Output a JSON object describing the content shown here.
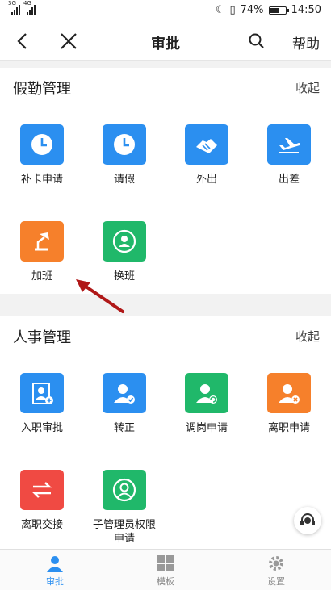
{
  "status_bar": {
    "signal1": "3G",
    "signal2": "4G",
    "battery": "74%",
    "battery_level": 0.74,
    "time": "14:50"
  },
  "header": {
    "title": "审批",
    "help": "帮助"
  },
  "sections": [
    {
      "title": "假勤管理",
      "collapse": "收起",
      "items": [
        {
          "label": "补卡申请",
          "color": "#2b8ff0",
          "icon": "clock-icon"
        },
        {
          "label": "请假",
          "color": "#2b8ff0",
          "icon": "clock-icon"
        },
        {
          "label": "外出",
          "color": "#2b8ff0",
          "icon": "handshake-icon"
        },
        {
          "label": "出差",
          "color": "#2b8ff0",
          "icon": "airplane-icon"
        },
        {
          "label": "加班",
          "color": "#f6802b",
          "icon": "desk-lamp-icon"
        },
        {
          "label": "换班",
          "color": "#20b86a",
          "icon": "swap-person-icon"
        }
      ]
    },
    {
      "title": "人事管理",
      "collapse": "收起",
      "items": [
        {
          "label": "入职审批",
          "color": "#2b8ff0",
          "icon": "id-card-plus-icon"
        },
        {
          "label": "转正",
          "color": "#2b8ff0",
          "icon": "user-check-icon"
        },
        {
          "label": "调岗申请",
          "color": "#20b86a",
          "icon": "user-refresh-icon"
        },
        {
          "label": "离职申请",
          "color": "#f6802b",
          "icon": "user-remove-icon"
        },
        {
          "label": "离职交接",
          "color": "#f04a43",
          "icon": "exchange-arrows-icon"
        },
        {
          "label": "子管理员权限申请",
          "color": "#20b86a",
          "icon": "user-shield-icon"
        }
      ]
    }
  ],
  "tabs": [
    {
      "label": "审批",
      "icon": "person-icon",
      "active": true
    },
    {
      "label": "模板",
      "icon": "grid-icon",
      "active": false
    },
    {
      "label": "设置",
      "icon": "gear-icon",
      "active": false
    }
  ]
}
